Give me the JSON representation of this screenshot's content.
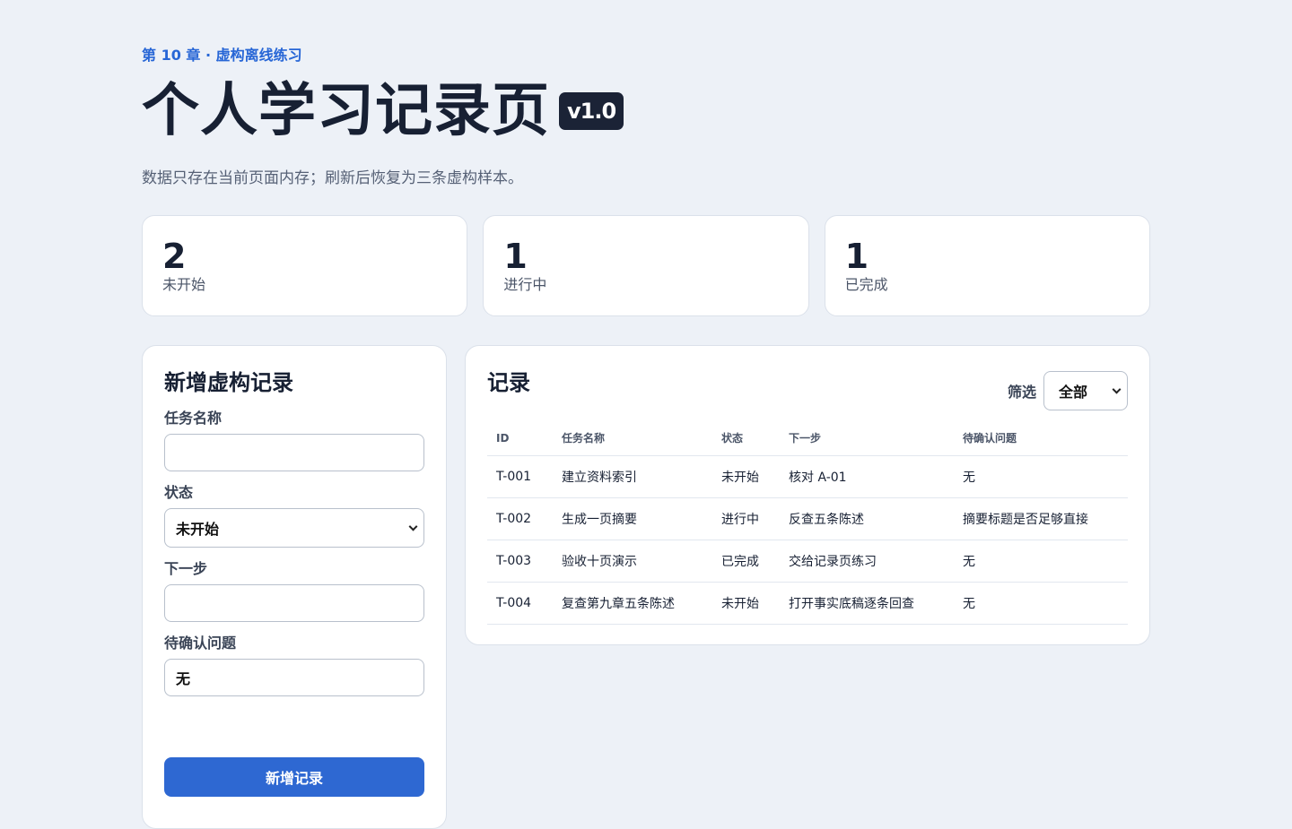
{
  "header": {
    "chapter": "第 10 章 · 虚构离线练习",
    "title": "个人学习记录页",
    "version": "v1.0",
    "subtitle": "数据只存在当前页面内存；刷新后恢复为三条虚构样本。"
  },
  "stats": [
    {
      "value": "2",
      "label": "未开始"
    },
    {
      "value": "1",
      "label": "进行中"
    },
    {
      "value": "1",
      "label": "已完成"
    }
  ],
  "form": {
    "title": "新增虚构记录",
    "task_name_label": "任务名称",
    "task_name_value": "",
    "status_label": "状态",
    "status_value": "未开始",
    "next_step_label": "下一步",
    "next_step_value": "",
    "pending_label": "待确认问题",
    "pending_value": "无",
    "submit_label": "新增记录"
  },
  "records": {
    "title": "记录",
    "filter_label": "筛选",
    "filter_value": "全部",
    "columns": [
      "ID",
      "任务名称",
      "状态",
      "下一步",
      "待确认问题"
    ],
    "rows": [
      [
        "T-001",
        "建立资料索引",
        "未开始",
        "核对 A-01",
        "无"
      ],
      [
        "T-002",
        "生成一页摘要",
        "进行中",
        "反查五条陈述",
        "摘要标题是否足够直接"
      ],
      [
        "T-003",
        "验收十页演示",
        "已完成",
        "交给记录页练习",
        "无"
      ],
      [
        "T-004",
        "复查第九章五条陈述",
        "未开始",
        "打开事实底稿逐条回查",
        "无"
      ]
    ]
  },
  "colors": {
    "accent": "#2e68d2",
    "background": "#edf1f7",
    "badge": "#1b2336"
  }
}
